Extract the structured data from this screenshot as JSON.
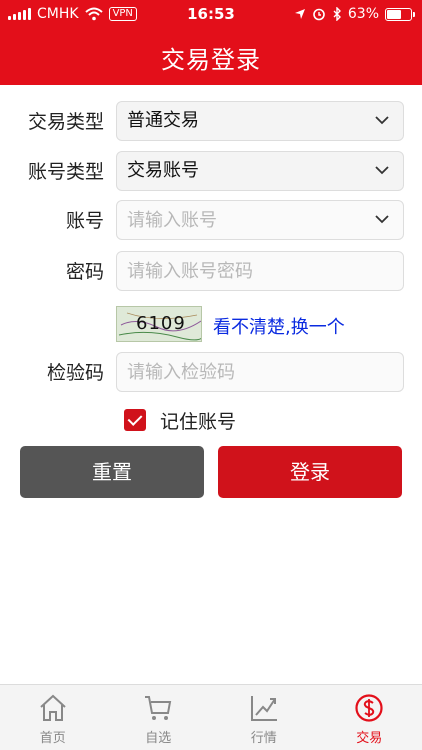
{
  "status_bar": {
    "carrier": "CMHK",
    "vpn": "VPN",
    "time": "16:53",
    "battery": "63%",
    "battery_level": 0.63
  },
  "header": {
    "title": "交易登录"
  },
  "form": {
    "trade_type": {
      "label": "交易类型",
      "value": "普通交易"
    },
    "account_type": {
      "label": "账号类型",
      "value": "交易账号"
    },
    "account": {
      "label": "账号",
      "placeholder": "请输入账号"
    },
    "password": {
      "label": "密码",
      "placeholder": "请输入账号密码"
    },
    "captcha": {
      "code": "6109",
      "refresh_link": "看不清楚,换一个"
    },
    "verify": {
      "label": "检验码",
      "placeholder": "请输入检验码"
    },
    "remember": {
      "label": "记住账号",
      "checked": true
    },
    "reset_button": "重置",
    "login_button": "登录"
  },
  "tabbar": {
    "items": [
      {
        "label": "首页",
        "icon": "home-icon"
      },
      {
        "label": "自选",
        "icon": "cart-icon"
      },
      {
        "label": "行情",
        "icon": "trend-chart-icon"
      },
      {
        "label": "交易",
        "icon": "dollar-circle-icon",
        "active": true
      }
    ]
  },
  "colors": {
    "accent": "#e30f1a",
    "reset": "#555555",
    "link": "#0b2be0"
  }
}
